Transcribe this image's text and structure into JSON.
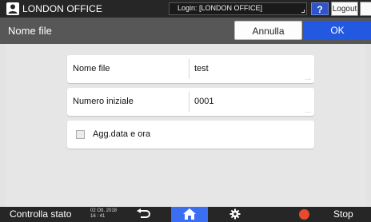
{
  "topbar": {
    "user_name": "LONDON OFFICE",
    "login_text": "Login: [LONDON OFFICE]",
    "help_label": "?",
    "logout_label": "Logout"
  },
  "titlebar": {
    "title": "Nome file",
    "cancel_label": "Annulla",
    "ok_label": "OK"
  },
  "form": {
    "fields": [
      {
        "label": "Nome file",
        "value": "test",
        "more": "..."
      },
      {
        "label": "Numero iniziale",
        "value": "0001",
        "more": "..."
      }
    ],
    "checkbox": {
      "label": "Agg.data e ora",
      "checked": false
    }
  },
  "bottombar": {
    "status_label": "Controlla stato",
    "date": "02 Ott. 2018",
    "time": "16 : 41",
    "stop_label": "Stop"
  },
  "colors": {
    "accent": "#2358e0",
    "home": "#3b6ef0",
    "stop": "#e84a2b"
  },
  "icons": [
    "user-icon",
    "moon-icon",
    "back-icon",
    "home-icon",
    "gear-icon",
    "stop-icon"
  ]
}
